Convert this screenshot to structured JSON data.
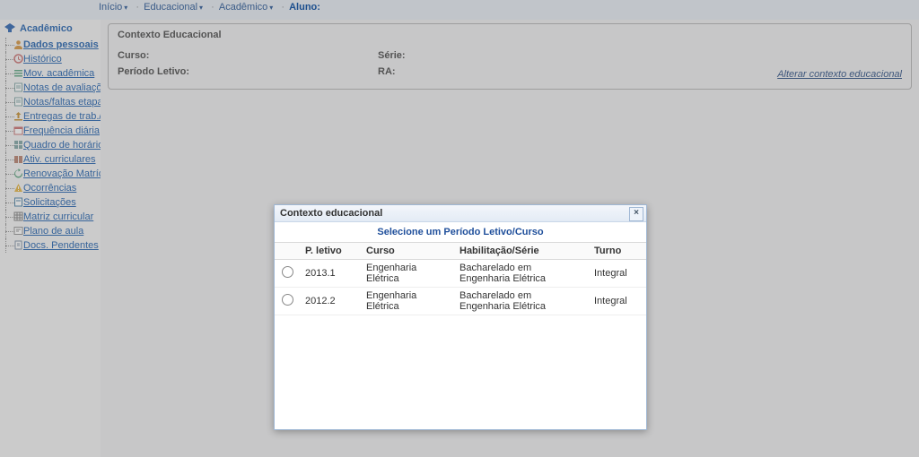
{
  "breadcrumb": {
    "items": [
      "Início",
      "Educacional",
      "Acadêmico"
    ],
    "last_label": "Aluno:"
  },
  "sidebar": {
    "group_title": "Acadêmico",
    "items": [
      {
        "label": "Dados pessoais",
        "icon": "user-icon",
        "active": true
      },
      {
        "label": "Histórico",
        "icon": "clock-icon"
      },
      {
        "label": "Mov. acadêmica",
        "icon": "list-icon"
      },
      {
        "label": "Notas de avaliações",
        "icon": "note-icon"
      },
      {
        "label": "Notas/faltas etapas",
        "icon": "note-icon"
      },
      {
        "label": "Entregas de trab./aval.",
        "icon": "upload-icon"
      },
      {
        "label": "Frequência diária",
        "icon": "calendar-icon"
      },
      {
        "label": "Quadro de horários",
        "icon": "grid-icon"
      },
      {
        "label": "Ativ. curriculares",
        "icon": "book-icon"
      },
      {
        "label": "Renovação Matrícula",
        "icon": "refresh-icon"
      },
      {
        "label": "Ocorrências",
        "icon": "alert-icon"
      },
      {
        "label": "Solicitações",
        "icon": "request-icon"
      },
      {
        "label": "Matriz curricular",
        "icon": "matrix-icon"
      },
      {
        "label": "Plano de aula",
        "icon": "plan-icon"
      },
      {
        "label": "Docs. Pendentes",
        "icon": "doc-icon"
      }
    ]
  },
  "context_panel": {
    "title": "Contexto Educacional",
    "curso_label": "Curso:",
    "serie_label": "Série:",
    "periodo_label": "Período Letivo:",
    "ra_label": "RA:",
    "alterar_link": "Alterar contexto educacional"
  },
  "modal": {
    "title": "Contexto educacional",
    "subtitle": "Selecione um Período Letivo/Curso",
    "columns": {
      "pletivo": "P. letivo",
      "curso": "Curso",
      "habil": "Habilitação/Série",
      "turno": "Turno"
    },
    "rows": [
      {
        "pletivo": "2013.1",
        "curso": "Engenharia Elétrica",
        "habil": "Bacharelado em Engenharia Elétrica",
        "turno": "Integral"
      },
      {
        "pletivo": "2012.2",
        "curso": "Engenharia Elétrica",
        "habil": "Bacharelado em Engenharia Elétrica",
        "turno": "Integral"
      }
    ]
  }
}
